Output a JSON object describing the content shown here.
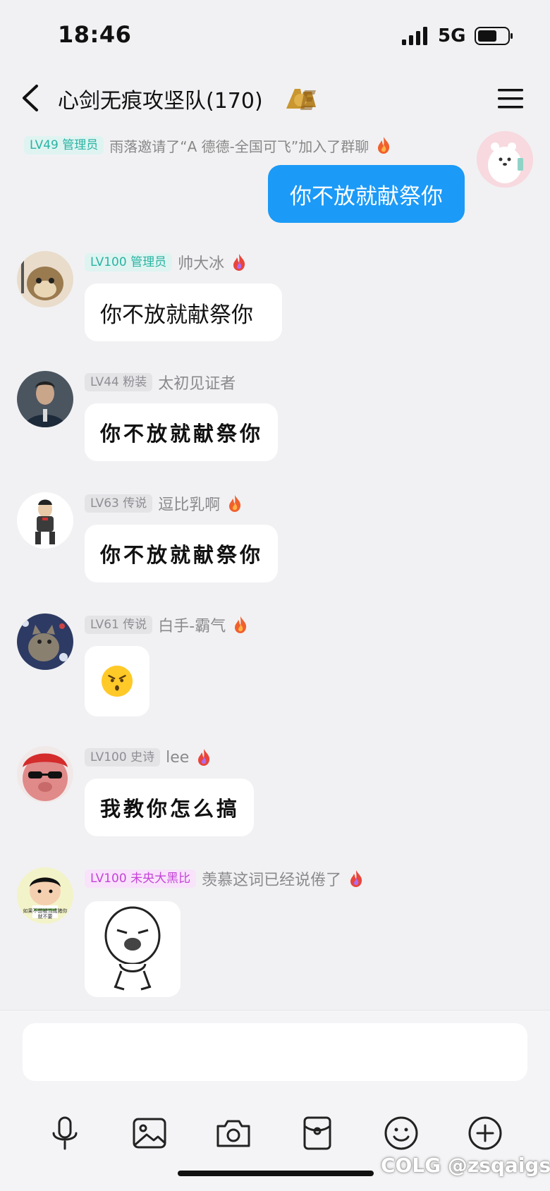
{
  "status_bar": {
    "time": "18:46",
    "network": "5G"
  },
  "nav": {
    "title": "心剑无痕攻坚队(170)"
  },
  "system_notice": {
    "level": "LV49 管理员",
    "text": "雨落邀请了“A 德德-全国可飞”加入了群聊"
  },
  "my_message": {
    "text": "你不放就献祭你"
  },
  "messages": [
    {
      "level": "LV100 管理员",
      "name": "帅大冰",
      "text": "你不放就献祭你"
    },
    {
      "level": "LV44 粉装",
      "name": "太初见证者",
      "text": "你不放就献祭你"
    },
    {
      "level": "LV63 传说",
      "name": "逗比乳啊",
      "text": "你不放就献祭你"
    },
    {
      "level": "LV61 传说",
      "name": "白手-霸气",
      "text": ""
    },
    {
      "level": "LV100 史诗",
      "name": "lee",
      "text": "我教你怎么搞"
    },
    {
      "level": "LV100 未央大黑比",
      "name": "羡慕这词已经说倦了",
      "text": ""
    }
  ],
  "avatar_caption": "如果不想被当成猪你就不要",
  "watermark": "COLG @zsqaigsq",
  "colors": {
    "accent_blue": "#1b9af7",
    "admin_teal": "#2ab3a3",
    "title_pink": "#c543d8",
    "background": "#f1f1f3"
  },
  "icons": [
    "signal-icon",
    "battery-icon",
    "back-icon",
    "ace-badge-icon",
    "menu-icon",
    "fire-icon",
    "microphone-icon",
    "image-icon",
    "camera-icon",
    "red-packet-icon",
    "emoji-icon",
    "plus-icon"
  ]
}
